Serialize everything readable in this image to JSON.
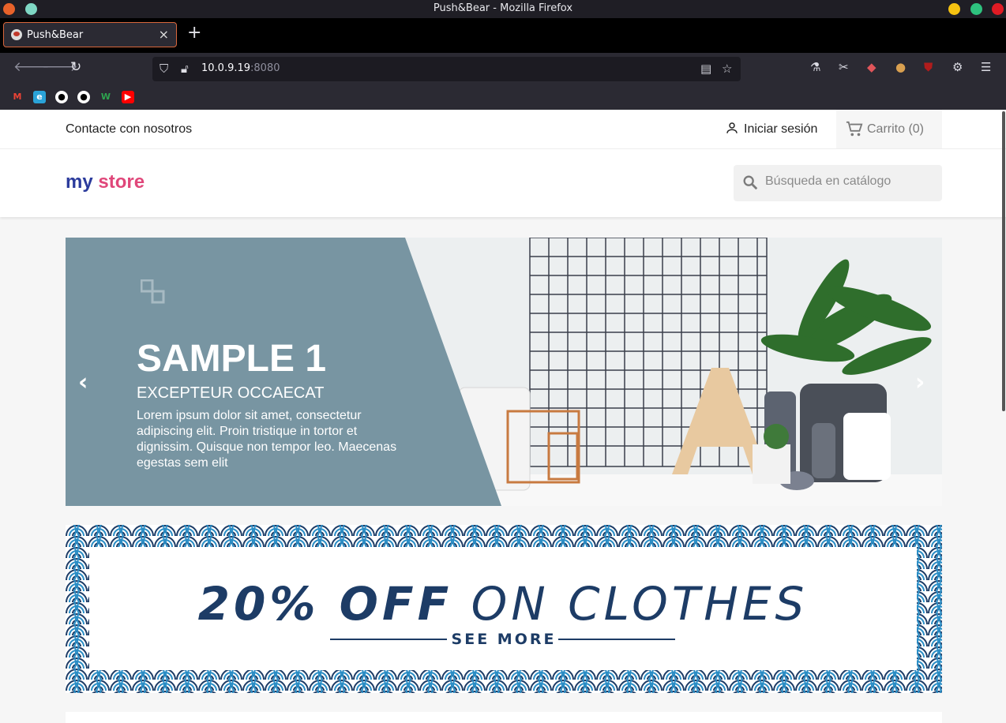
{
  "window": {
    "title": "Push&Bear - Mozilla Firefox"
  },
  "tab": {
    "label": "Push&Bear",
    "close": "×"
  },
  "newtab": {
    "label": "+"
  },
  "url": {
    "host": "10.0.9.19",
    "port": ":8080"
  },
  "bookmarks": [
    "gmail-icon",
    "edge-icon",
    "github-icon",
    "github-icon",
    "w-icon",
    "youtube-icon"
  ],
  "topnav": {
    "contact": "Contacte con nosotros",
    "login": "Iniciar sesión",
    "cart": "Carrito (0)"
  },
  "header": {
    "logo_my": "my",
    "logo_store": "store"
  },
  "search": {
    "placeholder": "Búsqueda en catálogo"
  },
  "slider": {
    "title": "SAMPLE 1",
    "subtitle": "EXCEPTEUR OCCAECAT",
    "description": "Lorem ipsum dolor sit amet, consectetur adipiscing elit. Proin tristique in tortor et dignissim. Quisque non tempor leo. Maecenas egestas sem elit",
    "prev": "‹",
    "next": "›"
  },
  "banner": {
    "title_bold": "20% OFF",
    "title_normal": "ON CLOTHES",
    "link": "SEE MORE"
  },
  "colors": {
    "panel": "#7895a2",
    "banner_text": "#1d3c66",
    "accent": "#d8663b"
  }
}
